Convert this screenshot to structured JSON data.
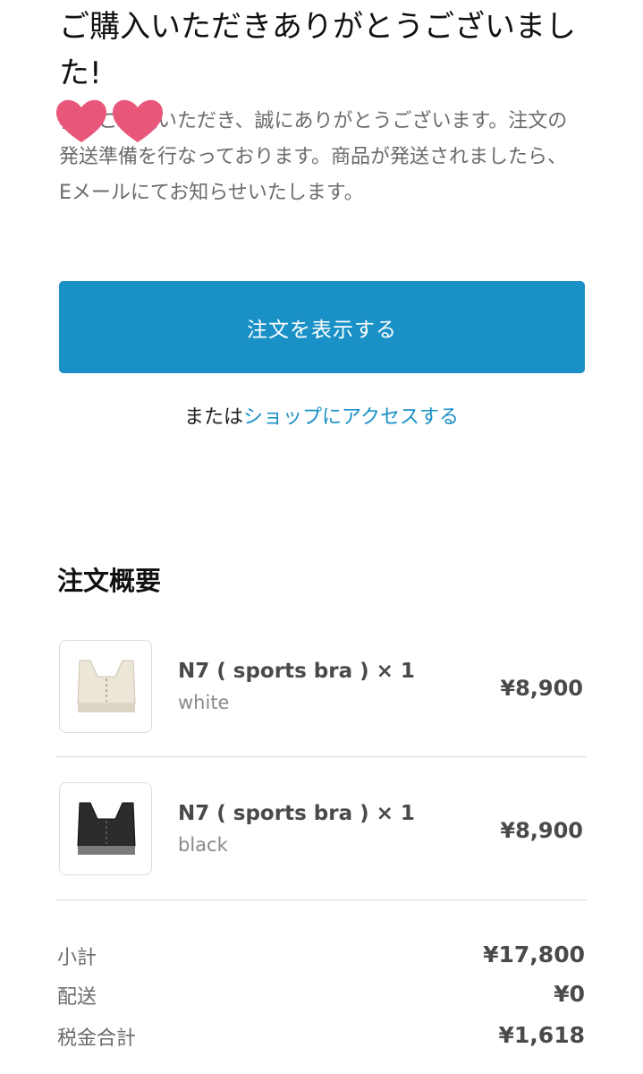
{
  "confirmation": {
    "title": "ご購入いただきありがとうございました!",
    "message": "様、ご注文いただき、誠にありがとうございます。注文の発送準備を行なっております。商品が発送されましたら、Eメールにてお知らせいたします。",
    "view_order_label": "注文を表示する",
    "alt_prefix": "または",
    "shop_link_label": "ショップにアクセスする"
  },
  "summary": {
    "heading": "注文概要",
    "items": [
      {
        "name": "N7 ( sports bra ) × 1",
        "variant": "white",
        "price": "¥8,900"
      },
      {
        "name": "N7 ( sports bra ) × 1",
        "variant": "black",
        "price": "¥8,900"
      }
    ],
    "totals": [
      {
        "label": "小計",
        "value": "¥17,800"
      },
      {
        "label": "配送",
        "value": "¥0"
      },
      {
        "label": "税金合計",
        "value": "¥1,618"
      }
    ]
  },
  "colors": {
    "accent": "#1990c6",
    "heart": "#e8567a"
  }
}
